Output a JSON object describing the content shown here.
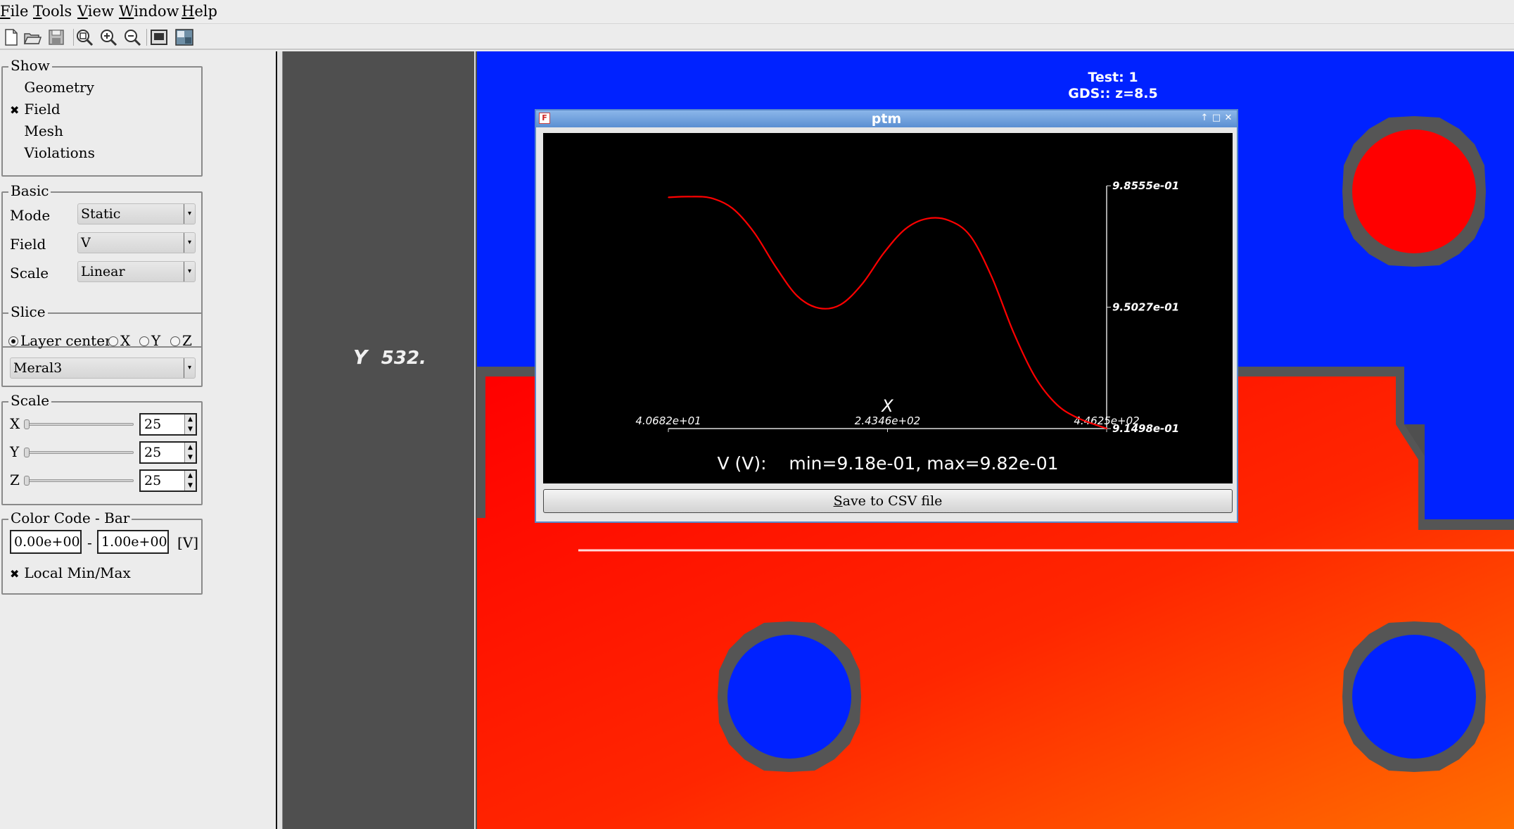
{
  "menubar": {
    "items": [
      {
        "accel": "F",
        "rest": "ile"
      },
      {
        "accel": "T",
        "rest": "ools"
      },
      {
        "accel": "V",
        "rest": "iew"
      },
      {
        "accel": "W",
        "rest": "indow"
      },
      {
        "accel": "H",
        "rest": "elp"
      }
    ]
  },
  "toolbar": {
    "icons": [
      "new-file-icon",
      "open-folder-icon",
      "save-icon",
      "zoom-fit-icon",
      "zoom-in-icon",
      "zoom-out-icon",
      "screenshot-icon",
      "image-export-icon"
    ]
  },
  "show": {
    "title": "Show",
    "items": [
      {
        "label": "Geometry",
        "checked": false
      },
      {
        "label": "Field",
        "checked": true
      },
      {
        "label": "Mesh",
        "checked": false
      },
      {
        "label": "Violations",
        "checked": false
      }
    ],
    "check_mark": "✖"
  },
  "basic": {
    "title": "Basic",
    "mode_label": "Mode",
    "mode_value": "Static",
    "field_label": "Field",
    "field_value": "V",
    "scale_label": "Scale",
    "scale_value": "Linear"
  },
  "slice": {
    "title": "Slice",
    "options": [
      "Layer center",
      "X",
      "Y",
      "Z"
    ],
    "selected": "Layer center",
    "layer": "Meral3"
  },
  "scale": {
    "title": "Scale",
    "axes": [
      {
        "label": "X",
        "value": "25"
      },
      {
        "label": "Y",
        "value": "25"
      },
      {
        "label": "Z",
        "value": "25"
      }
    ]
  },
  "colorcode": {
    "title": "Color Code - Bar",
    "min": "0.00e+00",
    "dash": "-",
    "max": "1.00e+00",
    "unit": "[V]",
    "local_minmax_label": "Local Min/Max",
    "local_minmax_checked": true
  },
  "viewport": {
    "y_axis_label": "Y",
    "y_value": "532.",
    "test_label": "Test: 1",
    "gds_label": "GDS:: z=8.5",
    "colors": {
      "high": "#ff0000",
      "low": "#0022ff",
      "conductor": "#555555",
      "background": "#4f4f4f",
      "gradient_end": "#ff6a00"
    }
  },
  "ptm": {
    "title": "ptm",
    "icon_letter": "F",
    "save_button": "Save to CSV file",
    "save_accel": "S",
    "save_rest": "ave to CSV file",
    "summary": "V (V):    min=9.18e-01, max=9.82e-01"
  },
  "chart_data": {
    "type": "line",
    "xlabel": "X",
    "ylabel": "",
    "x_ticks": [
      "4.0682e+01",
      "2.4346e+02",
      "4.4625e+02"
    ],
    "y_ticks": [
      "9.8555e-01",
      "9.5027e-01",
      "9.1498e-01"
    ],
    "xlim": [
      40.682,
      446.25
    ],
    "ylim": [
      0.91498,
      0.98555
    ],
    "line_color": "#ff0000",
    "series": [
      {
        "x": [
          40.7,
          60,
          80,
          100,
          120,
          140,
          160,
          180,
          200,
          220,
          240,
          260,
          280,
          300,
          320,
          340,
          360,
          380,
          400,
          420,
          446.3
        ],
        "values": [
          0.9822,
          0.9824,
          0.982,
          0.979,
          0.972,
          0.962,
          0.9535,
          0.95,
          0.951,
          0.957,
          0.966,
          0.973,
          0.976,
          0.9755,
          0.971,
          0.959,
          0.943,
          0.93,
          0.922,
          0.918,
          0.915
        ]
      }
    ]
  }
}
